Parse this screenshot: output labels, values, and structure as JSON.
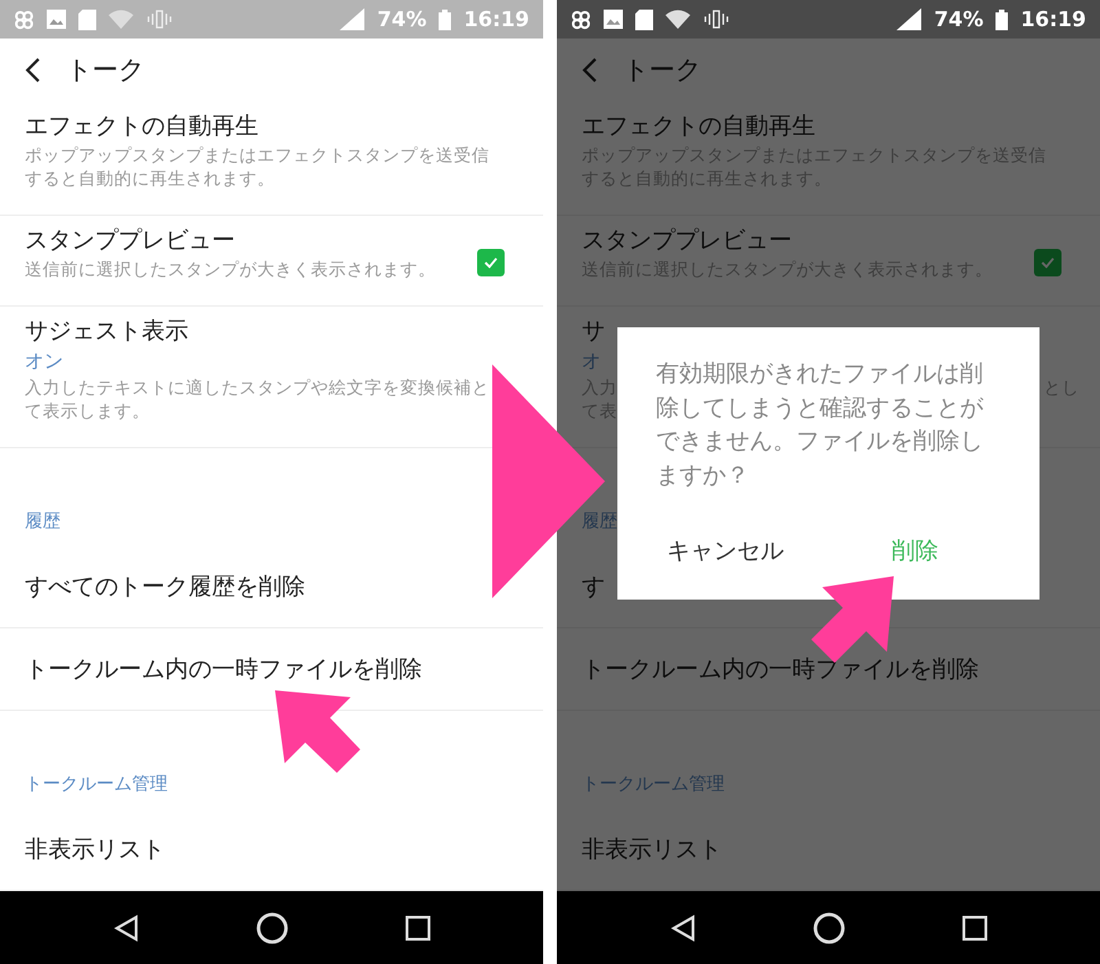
{
  "screens": [
    {
      "dimmed": false,
      "status_bar": {
        "battery": "74%",
        "time": "16:19"
      },
      "title": "トーク",
      "rows": [
        {
          "kind": "setting",
          "title": "エフェクトの自動再生",
          "description": "ポップアップスタンプまたはエフェクトスタンプを送受信すると自動的に再生されます。"
        },
        {
          "kind": "setting",
          "title": "スタンププレビュー",
          "description": "送信前に選択したスタンプが大きく表示されます。",
          "checked": true
        },
        {
          "kind": "setting",
          "title": "サジェスト表示",
          "value": "オン",
          "lines": [
            {
              "left": "入力したテキストに適したスタンプや絵文字を変換候補と"
            },
            {
              "left": "て表示します。"
            }
          ]
        },
        {
          "kind": "section",
          "title": "履歴"
        },
        {
          "kind": "action",
          "title": "すべてのトーク履歴を削除"
        },
        {
          "kind": "action",
          "title": "トークルーム内の一時ファイルを削除"
        },
        {
          "kind": "section",
          "title": "トークルーム管理"
        },
        {
          "kind": "action",
          "title": "非表示リスト"
        }
      ]
    },
    {
      "dimmed": true,
      "status_bar": {
        "battery": "74%",
        "time": "16:19"
      },
      "title": "トーク",
      "rows": [
        {
          "kind": "setting",
          "title": "エフェクトの自動再生",
          "description": "ポップアップスタンプまたはエフェクトスタンプを送受信すると自動的に再生されます。"
        },
        {
          "kind": "setting",
          "title": "スタンププレビュー",
          "description": "送信前に選択したスタンプが大きく表示されます。",
          "checked": true
        },
        {
          "kind": "partial",
          "title": "サ",
          "value": "オ",
          "lines": [
            {
              "left": "入力",
              "right": "とし"
            },
            {
              "left": "て表"
            }
          ]
        },
        {
          "kind": "section",
          "title": "履歴"
        },
        {
          "kind": "action",
          "title": "す"
        },
        {
          "kind": "action",
          "title": "トークルーム内の一時ファイルを削除"
        },
        {
          "kind": "section",
          "title": "トークルーム管理"
        },
        {
          "kind": "action",
          "title": "非表示リスト"
        }
      ],
      "dialog": {
        "message": "有効期限がきれたファイルは削除してしまうと確認することができません。ファイルを削除しますか？",
        "buttons": [
          {
            "label": "キャンセル",
            "kind": "cancel"
          },
          {
            "label": "削除",
            "kind": "confirm"
          }
        ]
      }
    }
  ]
}
